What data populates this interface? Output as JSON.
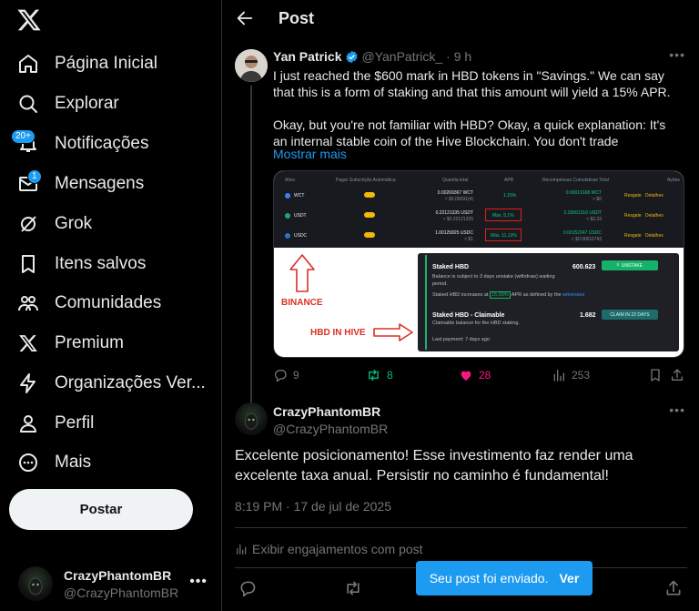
{
  "sidebar": {
    "items": [
      {
        "label": "Página Inicial",
        "icon": "home-icon"
      },
      {
        "label": "Explorar",
        "icon": "search-icon"
      },
      {
        "label": "Notificações",
        "icon": "bell-icon",
        "badge": "20+"
      },
      {
        "label": "Mensagens",
        "icon": "mail-icon",
        "badge": "1"
      },
      {
        "label": "Grok",
        "icon": "grok-icon"
      },
      {
        "label": "Itens salvos",
        "icon": "bookmark-icon"
      },
      {
        "label": "Comunidades",
        "icon": "communities-icon"
      },
      {
        "label": "Premium",
        "icon": "x-logo-icon"
      },
      {
        "label": "Organizações Ver...",
        "icon": "lightning-icon"
      },
      {
        "label": "Perfil",
        "icon": "person-icon"
      },
      {
        "label": "Mais",
        "icon": "more-circle-icon"
      }
    ],
    "post_button": "Postar",
    "account": {
      "name": "CrazyPhantomBR",
      "handle": "@CrazyPhantomBR"
    }
  },
  "header": {
    "title": "Post"
  },
  "tweet": {
    "author_name": "Yan Patrick",
    "author_handle": "@YanPatrick_",
    "time": "· 9 h",
    "text_p1": "I just reached the $600 mark in HBD tokens in \"Savings.\" We can say that this is a form of staking and that this amount will yield a 15% APR.",
    "text_p2": "Okay, but you're not familiar with HBD? Okay, a quick explanation: It's an internal stable coin of the Hive Blockchain. You don't trade",
    "show_more": "Mostrar mais",
    "media": {
      "binance_label": "BINANCE",
      "hive_label": "HBD IN HIVE",
      "table_headers": [
        "Ativo",
        "Pagar Subscrição Automática",
        "Quantia total",
        "APR",
        "Recompensas Cumulativas Total",
        "Ações"
      ],
      "rows": [
        {
          "asset": "WCT",
          "amount": "0.00269367 WCT",
          "amount_sub": "≈ $0.00091(4)",
          "apr": "1.15%",
          "reward": "0.00019168 WCT",
          "reward_sub": "≈ $0",
          "act1": "Resgate",
          "act2": "Detalhes"
        },
        {
          "asset": "USDT",
          "amount": "0.22121335 USDT",
          "amount_sub": "≈ $0.22121335",
          "apr": "Máx. 5.1%",
          "reward": "2.33661316 USDT",
          "reward_sub": "≈ $2.33",
          "act1": "Resgate",
          "act2": "Detalhes"
        },
        {
          "asset": "USDC",
          "amount": "1.00125825 USDC",
          "amount_sub": "≈ $1",
          "apr": "Máx. 11.13%",
          "reward": "0.00152247 USDC",
          "reward_sub": "≈ $0.00011743",
          "act1": "Resgate",
          "act2": "Detalhes"
        }
      ],
      "staked_title": "Staked HBD",
      "staked_value": "600.623",
      "staked_desc": "Balance is subject to 3 days unstake (withdraw) waiting period.",
      "staked_apr_pre": "Staked HBD increases at",
      "staked_apr": "15.00%",
      "staked_apr_post": "APR as defined by the",
      "staked_apr_link": "witnesses",
      "unstake_btn": "UNSTAKE",
      "claim_title": "Staked HBD - Claimable",
      "claim_value": "1.682",
      "claim_desc": "Claimable balance for the HBD staking.",
      "claim_btn": "CLAIM IN 22 DAYS",
      "last_payment": "Last payment: 7 days ago"
    },
    "replies": "9",
    "retweets": "8",
    "likes": "28",
    "views": "253"
  },
  "reply": {
    "author_name": "CrazyPhantomBR",
    "author_handle": "@CrazyPhantomBR",
    "text": "Excelente posicionamento! Esse investimento faz render uma excelente taxa anual. Persistir no caminho é fundamental!",
    "time": "8:19 PM · 17 de jul de 2025",
    "engagements": "Exibir engajamentos com post"
  },
  "toast": {
    "message": "Seu post foi enviado.",
    "link": "Ver"
  },
  "colors": {
    "accent": "#1d9bf0",
    "retweet": "#00ba7c",
    "like": "#f91880",
    "background": "#000000"
  }
}
